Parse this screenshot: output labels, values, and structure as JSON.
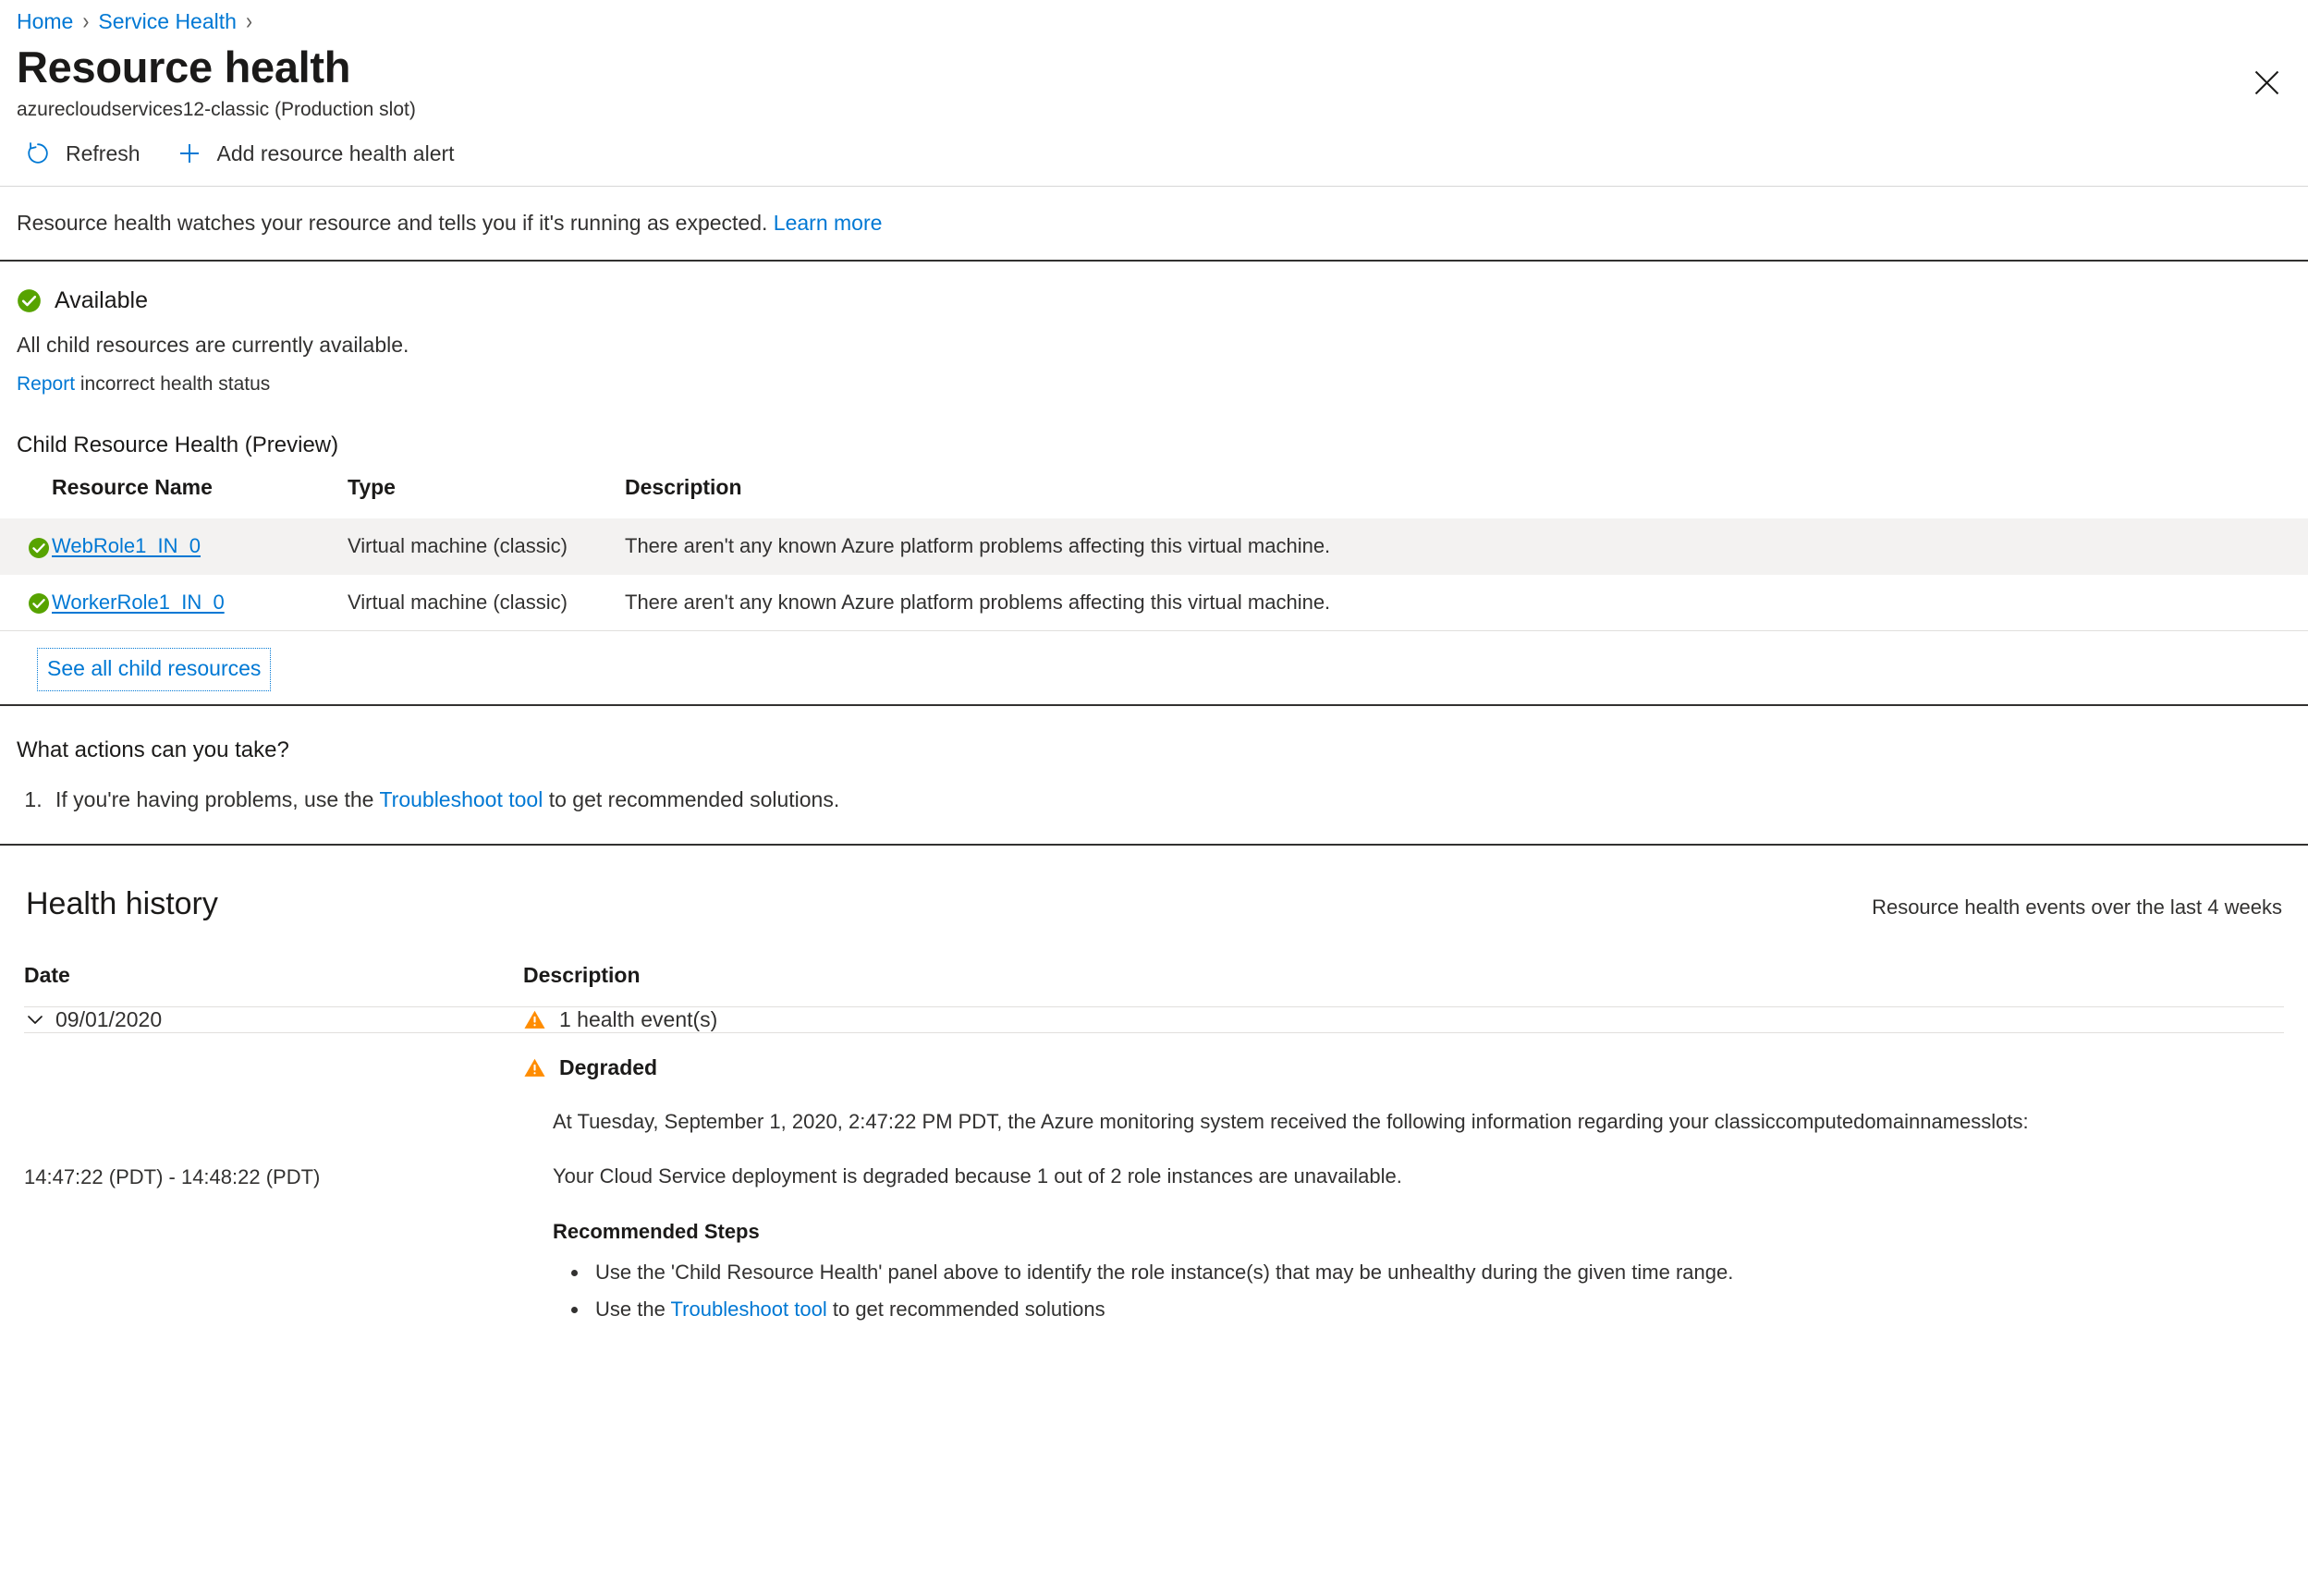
{
  "breadcrumb": {
    "items": [
      {
        "label": "Home"
      },
      {
        "label": "Service Health"
      }
    ],
    "separator": "›"
  },
  "header": {
    "title": "Resource health",
    "subtitle": "azurecloudservices12-classic (Production slot)",
    "close_icon": "close-icon"
  },
  "commandbar": {
    "refresh_label": "Refresh",
    "refresh_icon": "refresh-icon",
    "add_alert_label": "Add resource health alert",
    "add_alert_icon": "plus-icon"
  },
  "info": {
    "text": "Resource health watches your resource and tells you if it's running as expected.",
    "link_label": "Learn more"
  },
  "status": {
    "icon": "check-circle-icon",
    "label": "Available",
    "description": "All child resources are currently available.",
    "report_link": "Report",
    "report_rest": "incorrect health status"
  },
  "child_health": {
    "heading": "Child Resource Health (Preview)",
    "columns": [
      "Resource Name",
      "Type",
      "Description"
    ],
    "rows": [
      {
        "icon": "check-circle-icon",
        "name": "WebRole1_IN_0",
        "type": "Virtual machine (classic)",
        "description": "There aren't any known Azure platform problems affecting this virtual machine."
      },
      {
        "icon": "check-circle-icon",
        "name": "WorkerRole1_IN_0",
        "type": "Virtual machine (classic)",
        "description": "There aren't any known Azure platform problems affecting this virtual machine."
      }
    ],
    "see_all_label": "See all child resources"
  },
  "actions": {
    "title": "What actions can you take?",
    "item_prefix": "If you're having problems, use the",
    "item_link": "Troubleshoot tool",
    "item_suffix": "to get recommended solutions."
  },
  "health_history": {
    "title": "Health history",
    "note": "Resource health events over the last 4 weeks",
    "columns": [
      "Date",
      "Description"
    ],
    "date_row": {
      "chevron_icon": "chevron-down-icon",
      "date": "09/01/2020",
      "event_icon": "warning-triangle-icon",
      "event_count_label": "1 health event(s)"
    },
    "event": {
      "time_range": "14:47:22 (PDT) - 14:48:22 (PDT)",
      "status_icon": "warning-triangle-icon",
      "status_label": "Degraded",
      "paragraph_1": "At Tuesday, September 1, 2020, 2:47:22 PM PDT, the Azure monitoring system received the following information regarding your classiccomputedomainnamesslots:",
      "paragraph_2": "Your Cloud Service deployment is degraded because 1 out of 2 role instances are unavailable.",
      "recommended_title": "Recommended Steps",
      "recommended_steps": [
        {
          "prefix": "Use the 'Child Resource Health' panel above to identify the role instance(s) that may be unhealthy during the given time range.",
          "link": "",
          "suffix": ""
        },
        {
          "prefix": "Use the",
          "link": "Troubleshoot tool",
          "suffix": "to get recommended solutions"
        }
      ]
    }
  },
  "colors": {
    "accent": "#0078d4",
    "success": "#57a300",
    "warning": "#ff8c00",
    "text": "#323130"
  }
}
